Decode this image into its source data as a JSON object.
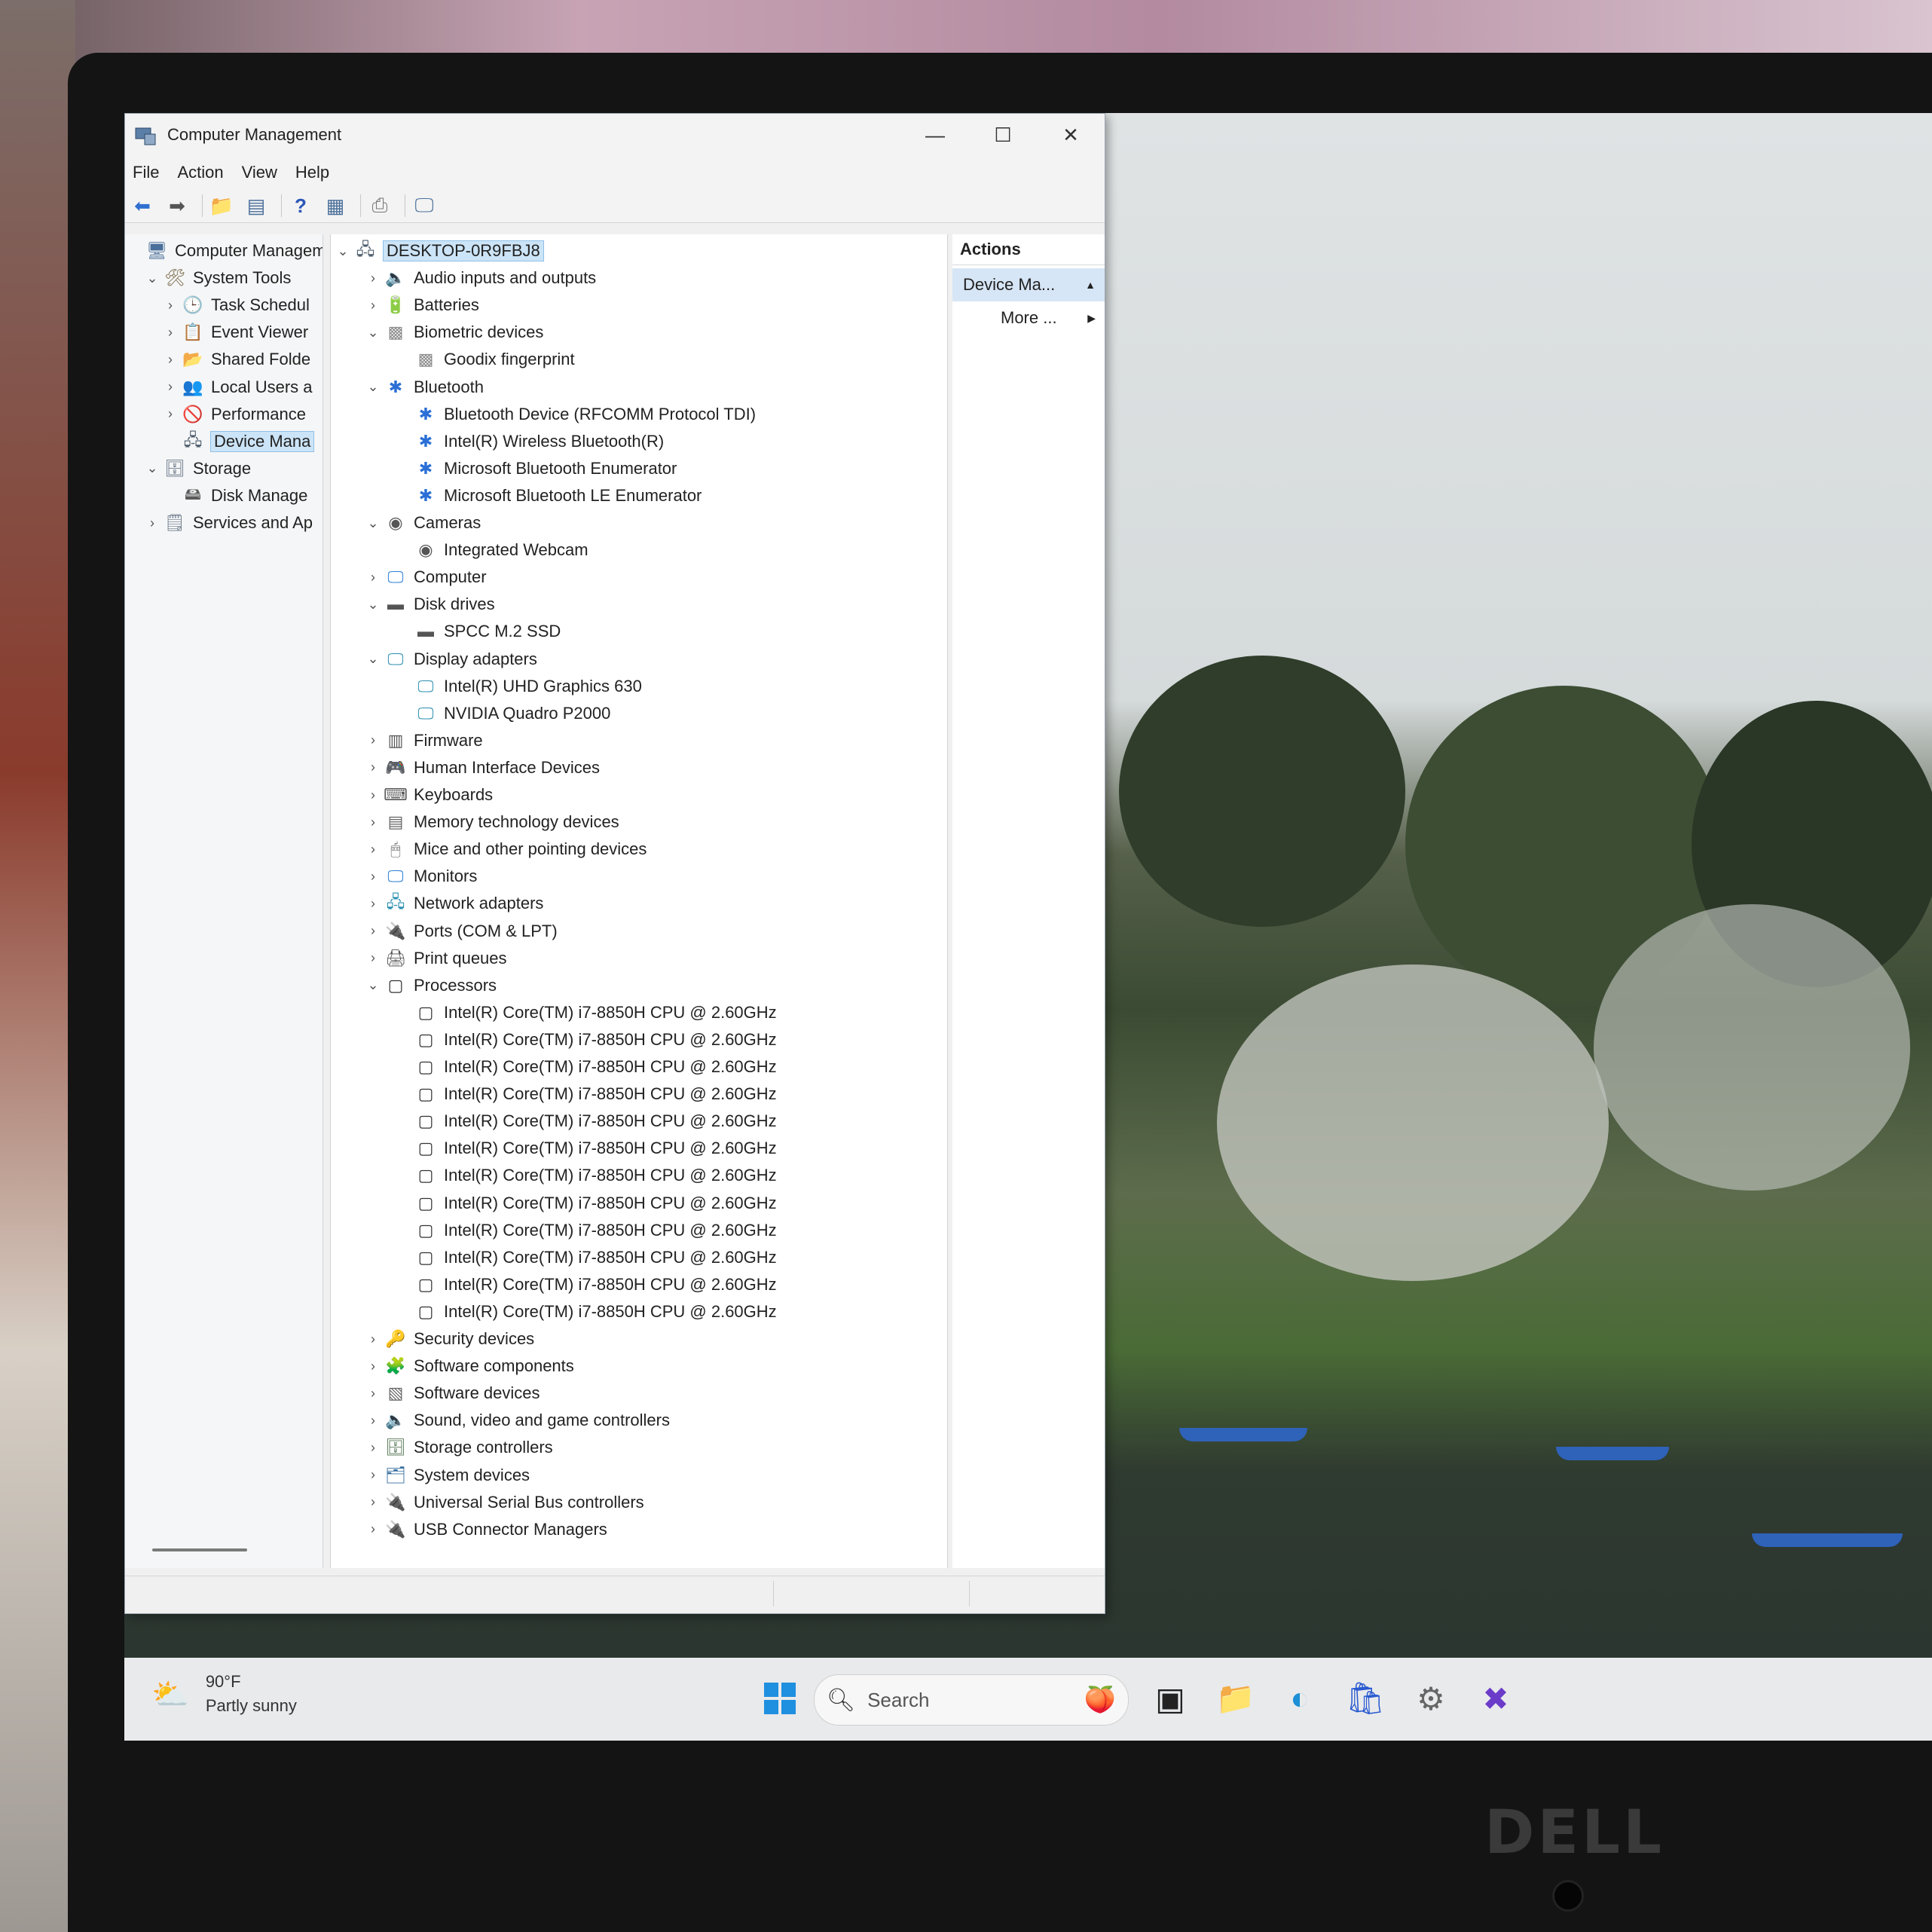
{
  "window": {
    "title": "Computer Management",
    "minimize_glyph": "—",
    "maximize_glyph": "☐",
    "close_glyph": "✕"
  },
  "menu": [
    "File",
    "Action",
    "View",
    "Help"
  ],
  "toolbar_icons": [
    "back-arrow-icon",
    "forward-arrow-icon",
    "up-folder-icon",
    "console-tree-icon",
    "help-icon",
    "properties-icon",
    "print-icon",
    "monitor-icon"
  ],
  "left_tree": [
    {
      "label": "Computer Managem",
      "indent": 0,
      "chevron": "",
      "icon": "computer-management-icon"
    },
    {
      "label": "System Tools",
      "indent": 1,
      "chevron": "v",
      "icon": "system-tools-icon"
    },
    {
      "label": "Task Schedul",
      "indent": 2,
      "chevron": ">",
      "icon": "task-scheduler-icon"
    },
    {
      "label": "Event Viewer",
      "indent": 2,
      "chevron": ">",
      "icon": "event-viewer-icon"
    },
    {
      "label": "Shared Folde",
      "indent": 2,
      "chevron": ">",
      "icon": "shared-folders-icon"
    },
    {
      "label": "Local Users a",
      "indent": 2,
      "chevron": ">",
      "icon": "local-users-icon"
    },
    {
      "label": "Performance",
      "indent": 2,
      "chevron": ">",
      "icon": "performance-icon"
    },
    {
      "label": "Device Mana",
      "indent": 2,
      "chevron": "",
      "icon": "device-manager-icon",
      "selected": true
    },
    {
      "label": "Storage",
      "indent": 1,
      "chevron": "v",
      "icon": "storage-icon"
    },
    {
      "label": "Disk Manage",
      "indent": 2,
      "chevron": "",
      "icon": "disk-management-icon"
    },
    {
      "label": "Services and Ap",
      "indent": 1,
      "chevron": ">",
      "icon": "services-icon"
    }
  ],
  "device_tree": [
    {
      "label": "DESKTOP-0R9FBJ8",
      "level": 0,
      "chevron": "v",
      "icon": "computer-root-icon",
      "selected": true
    },
    {
      "label": "Audio inputs and outputs",
      "level": 1,
      "chevron": ">",
      "icon": "speaker-icon"
    },
    {
      "label": "Batteries",
      "level": 1,
      "chevron": ">",
      "icon": "battery-icon"
    },
    {
      "label": "Biometric devices",
      "level": 1,
      "chevron": "v",
      "icon": "fingerprint-icon"
    },
    {
      "label": "Goodix fingerprint",
      "level": 2,
      "chevron": "",
      "icon": "fingerprint-icon"
    },
    {
      "label": "Bluetooth",
      "level": 1,
      "chevron": "v",
      "icon": "bluetooth-icon"
    },
    {
      "label": "Bluetooth Device (RFCOMM Protocol TDI)",
      "level": 2,
      "chevron": "",
      "icon": "bluetooth-icon"
    },
    {
      "label": "Intel(R) Wireless Bluetooth(R)",
      "level": 2,
      "chevron": "",
      "icon": "bluetooth-icon"
    },
    {
      "label": "Microsoft Bluetooth Enumerator",
      "level": 2,
      "chevron": "",
      "icon": "bluetooth-icon"
    },
    {
      "label": "Microsoft Bluetooth LE Enumerator",
      "level": 2,
      "chevron": "",
      "icon": "bluetooth-icon"
    },
    {
      "label": "Cameras",
      "level": 1,
      "chevron": "v",
      "icon": "camera-icon"
    },
    {
      "label": "Integrated Webcam",
      "level": 2,
      "chevron": "",
      "icon": "camera-icon"
    },
    {
      "label": "Computer",
      "level": 1,
      "chevron": ">",
      "icon": "computer-icon"
    },
    {
      "label": "Disk drives",
      "level": 1,
      "chevron": "v",
      "icon": "disk-drive-icon"
    },
    {
      "label": "SPCC M.2 SSD",
      "level": 2,
      "chevron": "",
      "icon": "disk-drive-icon"
    },
    {
      "label": "Display adapters",
      "level": 1,
      "chevron": "v",
      "icon": "display-adapter-icon"
    },
    {
      "label": "Intel(R) UHD Graphics 630",
      "level": 2,
      "chevron": "",
      "icon": "display-adapter-icon"
    },
    {
      "label": "NVIDIA Quadro P2000",
      "level": 2,
      "chevron": "",
      "icon": "display-adapter-icon"
    },
    {
      "label": "Firmware",
      "level": 1,
      "chevron": ">",
      "icon": "firmware-icon"
    },
    {
      "label": "Human Interface Devices",
      "level": 1,
      "chevron": ">",
      "icon": "hid-icon"
    },
    {
      "label": "Keyboards",
      "level": 1,
      "chevron": ">",
      "icon": "keyboard-icon"
    },
    {
      "label": "Memory technology devices",
      "level": 1,
      "chevron": ">",
      "icon": "memory-icon"
    },
    {
      "label": "Mice and other pointing devices",
      "level": 1,
      "chevron": ">",
      "icon": "mouse-icon"
    },
    {
      "label": "Monitors",
      "level": 1,
      "chevron": ">",
      "icon": "monitor-icon"
    },
    {
      "label": "Network adapters",
      "level": 1,
      "chevron": ">",
      "icon": "network-adapter-icon"
    },
    {
      "label": "Ports (COM & LPT)",
      "level": 1,
      "chevron": ">",
      "icon": "port-icon"
    },
    {
      "label": "Print queues",
      "level": 1,
      "chevron": ">",
      "icon": "printer-icon"
    },
    {
      "label": "Processors",
      "level": 1,
      "chevron": "v",
      "icon": "processor-icon"
    },
    {
      "label": "Intel(R) Core(TM) i7-8850H CPU @ 2.60GHz",
      "level": 2,
      "chevron": "",
      "icon": "processor-icon"
    },
    {
      "label": "Intel(R) Core(TM) i7-8850H CPU @ 2.60GHz",
      "level": 2,
      "chevron": "",
      "icon": "processor-icon"
    },
    {
      "label": "Intel(R) Core(TM) i7-8850H CPU @ 2.60GHz",
      "level": 2,
      "chevron": "",
      "icon": "processor-icon"
    },
    {
      "label": "Intel(R) Core(TM) i7-8850H CPU @ 2.60GHz",
      "level": 2,
      "chevron": "",
      "icon": "processor-icon"
    },
    {
      "label": "Intel(R) Core(TM) i7-8850H CPU @ 2.60GHz",
      "level": 2,
      "chevron": "",
      "icon": "processor-icon"
    },
    {
      "label": "Intel(R) Core(TM) i7-8850H CPU @ 2.60GHz",
      "level": 2,
      "chevron": "",
      "icon": "processor-icon"
    },
    {
      "label": "Intel(R) Core(TM) i7-8850H CPU @ 2.60GHz",
      "level": 2,
      "chevron": "",
      "icon": "processor-icon"
    },
    {
      "label": "Intel(R) Core(TM) i7-8850H CPU @ 2.60GHz",
      "level": 2,
      "chevron": "",
      "icon": "processor-icon"
    },
    {
      "label": "Intel(R) Core(TM) i7-8850H CPU @ 2.60GHz",
      "level": 2,
      "chevron": "",
      "icon": "processor-icon"
    },
    {
      "label": "Intel(R) Core(TM) i7-8850H CPU @ 2.60GHz",
      "level": 2,
      "chevron": "",
      "icon": "processor-icon"
    },
    {
      "label": "Intel(R) Core(TM) i7-8850H CPU @ 2.60GHz",
      "level": 2,
      "chevron": "",
      "icon": "processor-icon"
    },
    {
      "label": "Intel(R) Core(TM) i7-8850H CPU @ 2.60GHz",
      "level": 2,
      "chevron": "",
      "icon": "processor-icon"
    },
    {
      "label": "Security devices",
      "level": 1,
      "chevron": ">",
      "icon": "security-device-icon"
    },
    {
      "label": "Software components",
      "level": 1,
      "chevron": ">",
      "icon": "software-component-icon"
    },
    {
      "label": "Software devices",
      "level": 1,
      "chevron": ">",
      "icon": "software-device-icon"
    },
    {
      "label": "Sound, video and game controllers",
      "level": 1,
      "chevron": ">",
      "icon": "speaker-icon"
    },
    {
      "label": "Storage controllers",
      "level": 1,
      "chevron": ">",
      "icon": "storage-controller-icon"
    },
    {
      "label": "System devices",
      "level": 1,
      "chevron": ">",
      "icon": "system-device-icon"
    },
    {
      "label": "Universal Serial Bus controllers",
      "level": 1,
      "chevron": ">",
      "icon": "usb-icon"
    },
    {
      "label": "USB Connector Managers",
      "level": 1,
      "chevron": ">",
      "icon": "usb-icon"
    }
  ],
  "actions": {
    "title": "Actions",
    "section": "Device Ma...",
    "more": "More ..."
  },
  "taskbar": {
    "temperature": "90°F",
    "condition": "Partly sunny",
    "search_placeholder": "Search",
    "apps": [
      "windows-start-icon",
      "task-view-icon",
      "file-explorer-icon",
      "edge-browser-icon",
      "microsoft-store-icon",
      "settings-gear-icon",
      "xbox-app-icon"
    ]
  },
  "bezel_logo": "DELL",
  "colors": {
    "selection": "#cce4f7",
    "bluetooth": "#2a6fd6",
    "accent": "#0067c0"
  }
}
